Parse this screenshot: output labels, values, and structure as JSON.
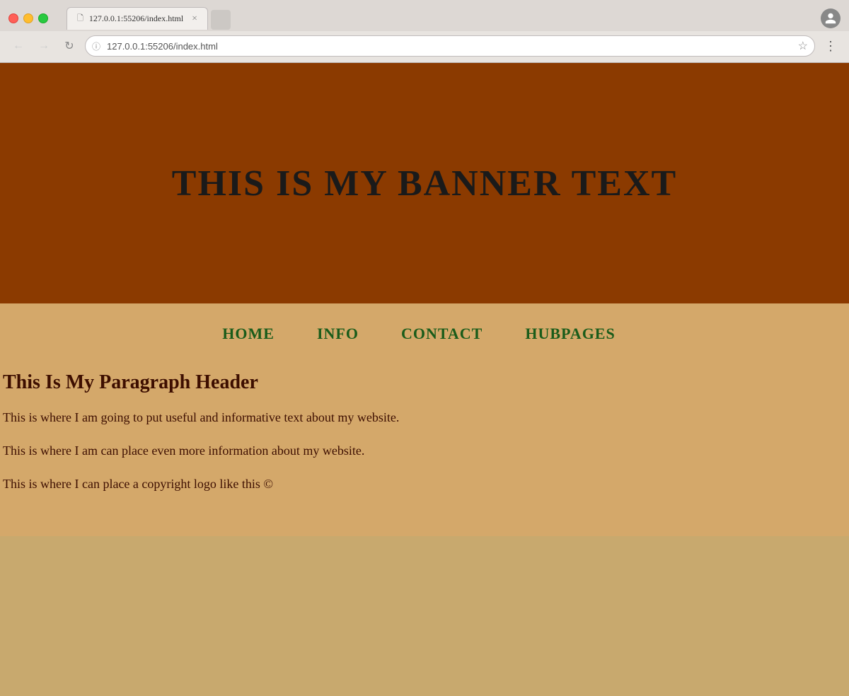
{
  "browser": {
    "url": "127.0.0.1:55206/index.html",
    "url_full": "127.0.0.1:55206/index.html",
    "tab_title": "127.0.0.1:55206/index.html",
    "close_label": "×",
    "back_icon": "←",
    "forward_icon": "→",
    "reload_icon": "↻",
    "star_icon": "☆",
    "menu_icon": "⋮",
    "profile_icon": "person"
  },
  "website": {
    "banner_text": "THIS IS MY BANNER TEXT",
    "nav": {
      "home": "HOME",
      "info": "INFO",
      "contact": "CONTACT",
      "hubpages": "HUBPAGES"
    },
    "paragraph_header": "This Is My Paragraph Header",
    "paragraph1": "This is where I am going to put useful and informative text about my website.",
    "paragraph2": "This is where I am can place even more information about my website.",
    "paragraph3": "This is where I can place a copyright logo like this ©"
  },
  "colors": {
    "banner_bg": "#8B3A00",
    "content_bg": "#d4a86a",
    "nav_link_color": "#1a5c1a",
    "text_color": "#3d0e00",
    "banner_text_color": "#1a1a1a"
  }
}
